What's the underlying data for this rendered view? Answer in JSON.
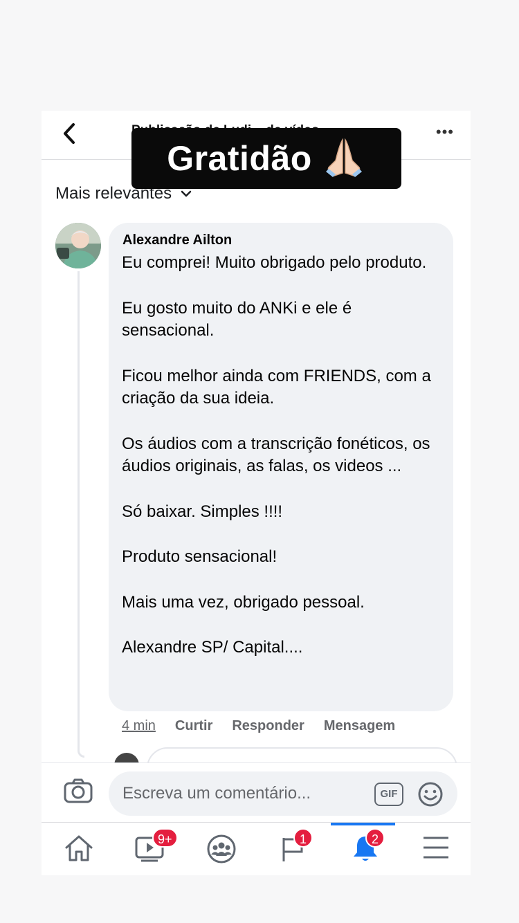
{
  "header": {
    "title": "Publicação de Ludi... de vídeo...",
    "more_label": "•••"
  },
  "story_tag": {
    "text": "Gratidão",
    "emoji": "🙏🏼"
  },
  "sort": {
    "label": "Mais relevantes"
  },
  "comment": {
    "author": "Alexandre Ailton",
    "paragraphs": [
      "Eu comprei! Muito obrigado pelo produto.",
      "Eu gosto muito do ANKi e ele é sensacional.",
      "Ficou melhor ainda com FRIENDS, com a criação da sua ideia.",
      "Os áudios com a transcrição fonéticos, os áudios originais, as falas, os videos ...",
      "Só baixar. Simples !!!!",
      "Produto sensacional!",
      "Mais uma vez, obrigado pessoal.",
      "Alexandre SP/ Capital...."
    ],
    "time": "4 min",
    "like_label": "Curtir",
    "reply_label": "Responder",
    "message_label": "Mensagem"
  },
  "composer": {
    "placeholder": "Escreva um comentário...",
    "gif_label": "GIF"
  },
  "tabs": {
    "video_badge": "9+",
    "pages_badge": "1",
    "notifications_badge": "2"
  },
  "colors": {
    "accent": "#1877f2",
    "badge": "#e41e3f",
    "bubble": "#f0f2f5"
  }
}
